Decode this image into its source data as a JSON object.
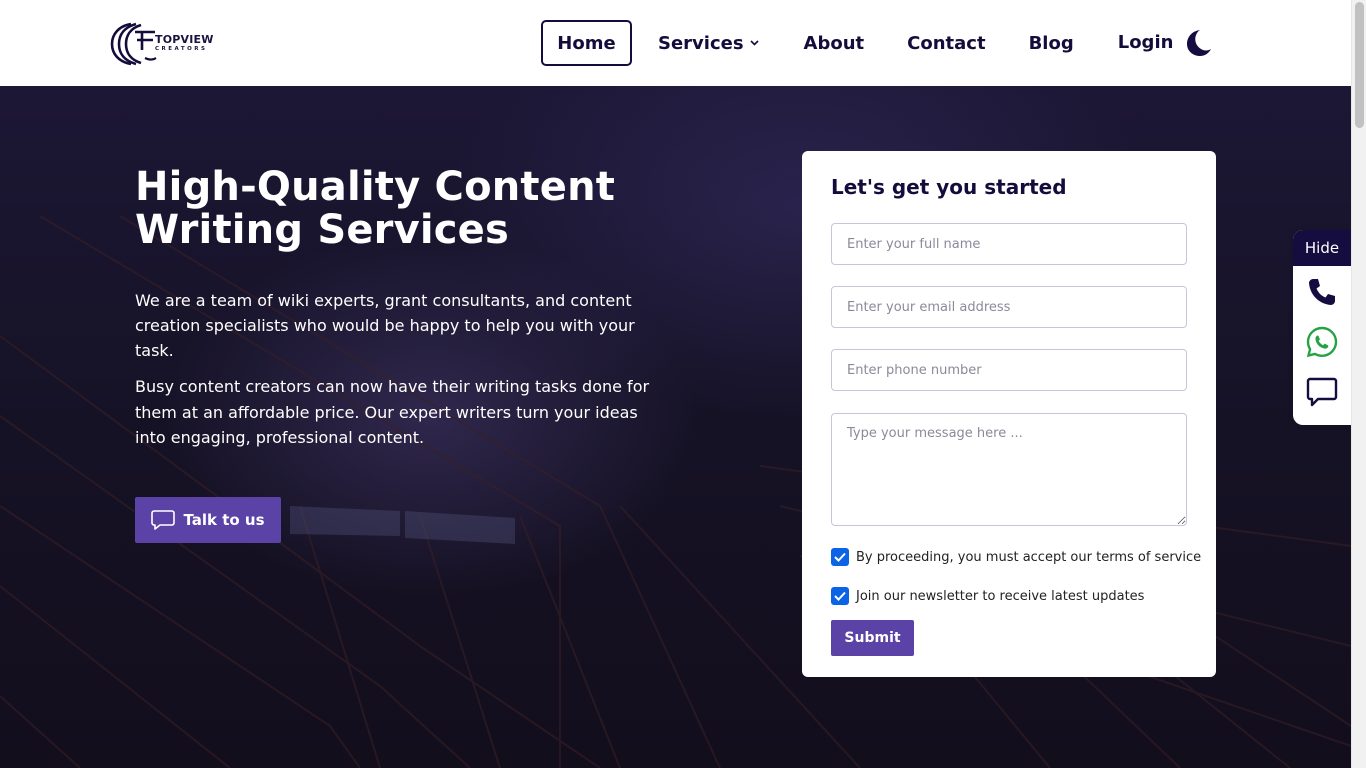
{
  "brand": {
    "name_line1": "TOPVIEW",
    "name_line2": "CREATORS",
    "color": "#140c3a"
  },
  "nav": {
    "items": [
      {
        "label": "Home",
        "active": true
      },
      {
        "label": "Services"
      },
      {
        "label": "About"
      },
      {
        "label": "Contact"
      },
      {
        "label": "Blog"
      },
      {
        "label": "Login"
      }
    ],
    "theme_icon": "moon-icon"
  },
  "hero": {
    "title": "High-Quality Content Writing Services",
    "paragraph1": "We are a team of wiki experts, grant consultants, and content creation specialists who would be happy to help you with your task.",
    "paragraph2": "Busy content creators can now have their writing tasks done for them at an affordable price. Our expert writers turn your ideas into engaging, professional content.",
    "cta_label": "Talk to us",
    "cta_icon": "chat-bubble-icon",
    "accent_color": "#5a42a6"
  },
  "form": {
    "title": "Let's get you started",
    "name_placeholder": "Enter your full name",
    "email_placeholder": "Enter your email address",
    "phone_placeholder": "Enter phone number",
    "message_placeholder": "Type your message here ...",
    "terms_label": "By proceeding, you must accept our terms of service",
    "terms_checked": true,
    "newsletter_label": "Join our newsletter to receive latest updates",
    "newsletter_checked": true,
    "submit_label": "Submit",
    "checkbox_color": "#0b63e5"
  },
  "side_widget": {
    "hide_label": "Hide",
    "icons": [
      "phone-icon",
      "whatsapp-icon",
      "message-icon"
    ]
  }
}
